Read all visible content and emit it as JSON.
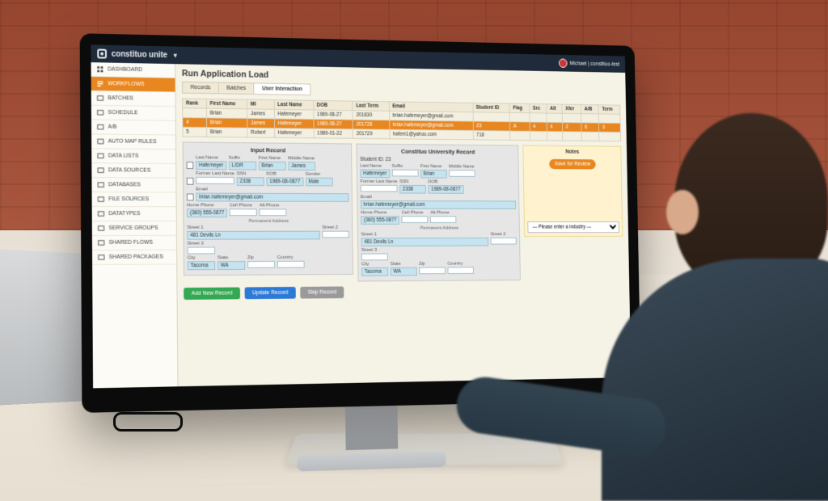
{
  "brand": {
    "name": "constituo unite"
  },
  "user": {
    "label": "Michael | constituo-test"
  },
  "sidebar": {
    "items": [
      {
        "label": "DASHBOARD"
      },
      {
        "label": "WORKFLOWS"
      },
      {
        "label": "BATCHES"
      },
      {
        "label": "SCHEDULE"
      },
      {
        "label": "A/B"
      },
      {
        "label": "AUTO MAP RULES"
      },
      {
        "label": "DATA LISTS"
      },
      {
        "label": "DATA SOURCES"
      },
      {
        "label": "DATABASES"
      },
      {
        "label": "FILE SOURCES"
      },
      {
        "label": "DATATYPES"
      },
      {
        "label": "SERVICE GROUPS"
      },
      {
        "label": "SHARED FLOWS"
      },
      {
        "label": "SHARED PACKAGES"
      }
    ],
    "active_index": 1
  },
  "page": {
    "title": "Run Application Load"
  },
  "tabs": {
    "items": [
      {
        "label": "Records"
      },
      {
        "label": "Batches"
      },
      {
        "label": "User Interaction"
      }
    ],
    "active_index": 2
  },
  "grid": {
    "headers": [
      "Rank",
      "First Name",
      "MI",
      "Last Name",
      "DOB",
      "Last Term",
      "Email",
      "Student ID",
      "Flag",
      "Src",
      "Alt",
      "Xfer",
      "A/B",
      "Term"
    ],
    "rows": [
      {
        "cells": [
          "",
          "Brian",
          "James",
          "Hafemeyer",
          "1989-08-27",
          "201830",
          "brian.hafemeyer@gmail.com",
          "",
          "",
          "",
          "",
          "",
          "",
          ""
        ],
        "selected": false
      },
      {
        "cells": [
          "4",
          "Brian",
          "James",
          "Hafemeyer",
          "1989-08-27",
          "201728",
          "brian.hafemeyer@gmail.com",
          "23",
          "A",
          "4",
          "4",
          "2",
          "6",
          "3"
        ],
        "selected": true
      },
      {
        "cells": [
          "5",
          "Brian",
          "Robert",
          "Hafemeyer",
          "1989-01-22",
          "201729",
          "hafem1@yahoo.com",
          "718",
          "",
          "",
          "",
          "",
          "",
          ""
        ],
        "selected": false
      }
    ]
  },
  "input_record": {
    "title": "Input Record",
    "last_name": "Hafemeyer",
    "suffix": "L/DR",
    "first_name": "Brian",
    "middle": "James",
    "former_last_name": "",
    "ssn": "2338",
    "dob": "1989-08-0877",
    "gender": "Male",
    "email": "brian.hafemeyer@gmail.com",
    "home_phone": "(360) 555-0877",
    "cell_phone": "",
    "alt_phone": "",
    "perm_addr_label": "Permanent Address",
    "street1": "481 Devils Ln",
    "street2": "",
    "street3": "",
    "city": "Tacoma",
    "state": "WA",
    "zip": "",
    "country": ""
  },
  "univ_record": {
    "title": "Constituo University Record",
    "student_id_label": "Student ID:",
    "student_id": "23",
    "last_name": "Hafemeyer",
    "suffix": "",
    "first_name": "Brian",
    "middle": "",
    "former_last_name": "",
    "ssn": "2338",
    "dob": "1989-08-0877",
    "email": "brian.hafemeyer@gmail.com",
    "home_phone": "(360) 555-0877",
    "cell_phone": "",
    "alt_phone": "",
    "perm_addr_label": "Permanent Address",
    "street1": "481 Devils Ln",
    "street2": "",
    "street3": "",
    "city": "Tacoma",
    "state": "WA",
    "zip": "",
    "country": ""
  },
  "notes": {
    "title": "Notes",
    "save_label": "Save for Review",
    "industry_placeholder": "— Please enter a industry —"
  },
  "actions": {
    "add": "Add New Record",
    "update": "Update Record",
    "skip": "Skip Record"
  },
  "field_labels": {
    "last_name": "Last Name",
    "suffix": "Suffix",
    "first_name": "First Name",
    "middle": "Middle Name",
    "former_last_name": "Former Last Name",
    "ssn": "SSN",
    "dob": "DOB",
    "gender": "Gender",
    "email": "Email",
    "home_phone": "Home Phone",
    "cell_phone": "Cell Phone",
    "alt_phone": "Alt Phone",
    "street1": "Street 1",
    "street2": "Street 2",
    "street3": "Street 3",
    "city": "City",
    "state": "State",
    "zip": "Zip",
    "country": "Country"
  }
}
